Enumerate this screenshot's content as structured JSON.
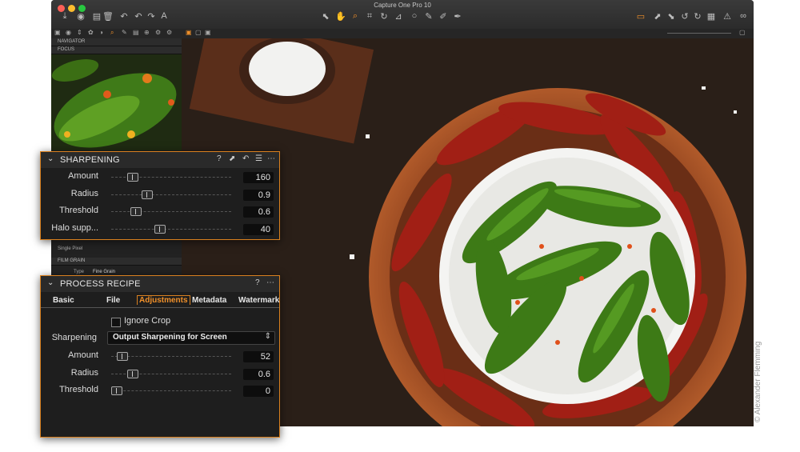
{
  "app": {
    "title": "Capture One Pro 10"
  },
  "left_panel": {
    "sections": [
      "NAVIGATOR",
      "FOCUS"
    ],
    "minor": {
      "single_pixel_label": "Single Pixel",
      "film_grain_header": "FILM GRAIN",
      "type_label": "Type",
      "type_value": "Fine Grain"
    }
  },
  "sharpening": {
    "title": "SHARPENING",
    "rows": [
      {
        "label": "Amount",
        "value": "160",
        "level": 0.15
      },
      {
        "label": "Radius",
        "value": "0.9",
        "level": 0.28
      },
      {
        "label": "Threshold",
        "value": "0.6",
        "level": 0.18
      },
      {
        "label": "Halo supp...",
        "value": "40",
        "level": 0.4
      }
    ]
  },
  "process_recipe": {
    "title": "PROCESS RECIPE",
    "tabs": [
      {
        "label": "Basic"
      },
      {
        "label": "File"
      },
      {
        "label": "Adjustments",
        "active": true
      },
      {
        "label": "Metadata"
      },
      {
        "label": "Watermark"
      }
    ],
    "ignore_crop_label": "Ignore Crop",
    "sharpening_label": "Sharpening",
    "sharpening_value": "Output Sharpening for Screen",
    "rows": [
      {
        "label": "Amount",
        "value": "52",
        "level": 0.05
      },
      {
        "label": "Radius",
        "value": "0.6",
        "level": 0.15
      },
      {
        "label": "Threshold",
        "value": "0",
        "level": 0.0
      }
    ]
  },
  "credit": "© Alexander Flemming",
  "colors": {
    "accent": "#d9801f",
    "active_tab": "#f0902a",
    "window": "#1b1b1b"
  }
}
